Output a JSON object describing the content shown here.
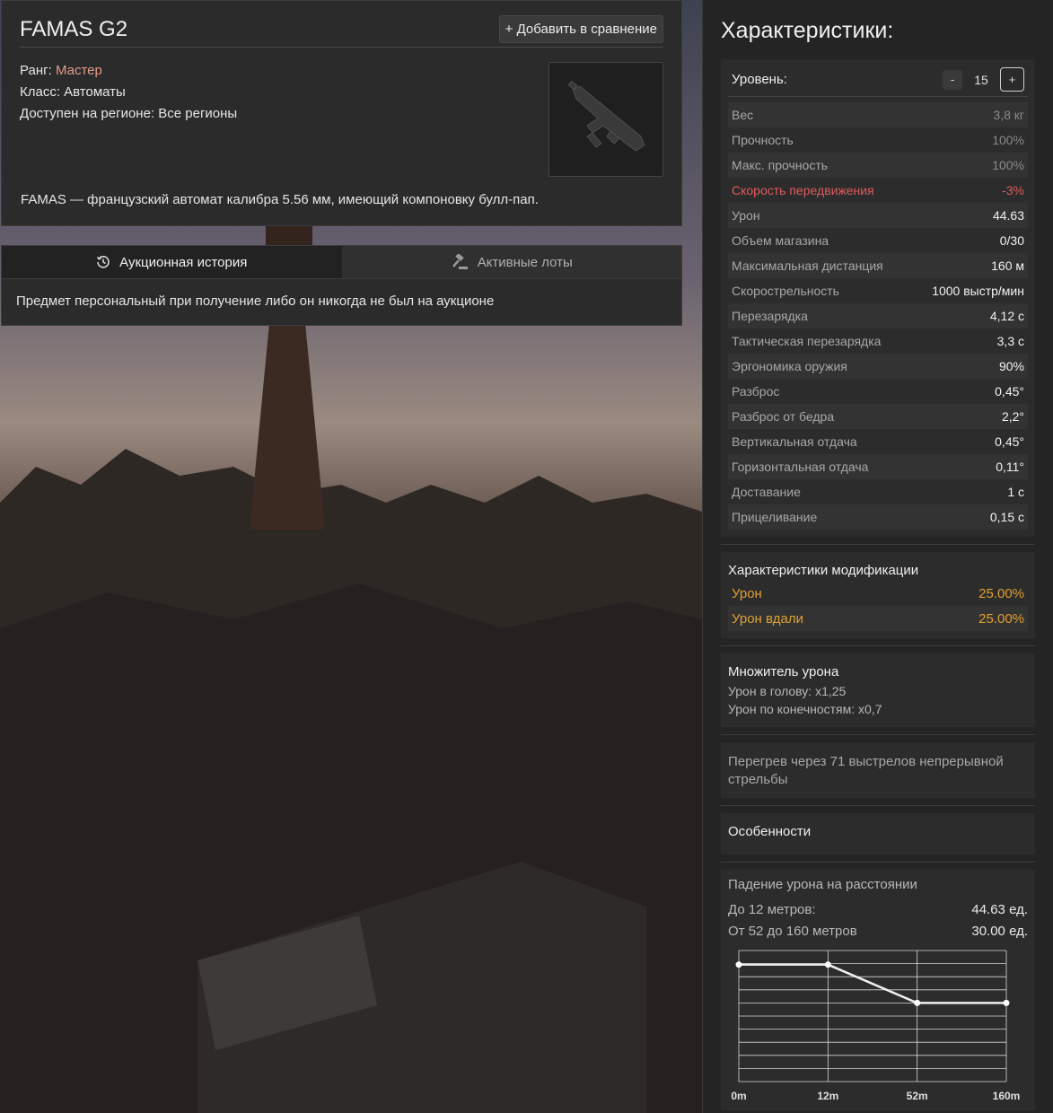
{
  "item": {
    "name": "FAMAS G2",
    "compare_label": "Добавить в сравнение",
    "rank_label": "Ранг:",
    "rank_value": "Мастер",
    "class_line": "Класс: Автоматы",
    "region_line": "Доступен на регионе: Все регионы",
    "description": "FAMAS — французский автомат калибра 5.56 мм, имеющий компоновку булл-пап.",
    "colors": {
      "rank": "#e39b8e"
    }
  },
  "auction": {
    "tabs": [
      {
        "label": "Аукционная история",
        "icon": "history-icon",
        "active": true
      },
      {
        "label": "Активные лоты",
        "icon": "gavel-icon",
        "active": false
      }
    ],
    "message": "Предмет персональный при получение либо он никогда не был на аукционе"
  },
  "stats": {
    "title": "Характеристики:",
    "level_label": "Уровень:",
    "level_value": "15",
    "minus": "-",
    "plus": "+",
    "rows": [
      {
        "name": "Вес",
        "value": "3,8 кг"
      },
      {
        "name": "Прочность",
        "value": "100%"
      },
      {
        "name": "Макс. прочность",
        "value": "100%"
      },
      {
        "name": "Скорость передвижения",
        "value": "-3%"
      },
      {
        "name": "Урон",
        "value": "44.63"
      },
      {
        "name": "Объем магазина",
        "value": "0/30"
      },
      {
        "name": "Максимальная дистанция",
        "value": "160 м"
      },
      {
        "name": "Скорострельность",
        "value": "1000 выстр/мин"
      },
      {
        "name": "Перезарядка",
        "value": "4,12 с"
      },
      {
        "name": "Тактическая перезарядка",
        "value": "3,3 с"
      },
      {
        "name": "Эргономика оружия",
        "value": "90%"
      },
      {
        "name": "Разброс",
        "value": "0,45°"
      },
      {
        "name": "Разброс от бедра",
        "value": "2,2°"
      },
      {
        "name": "Вертикальная отдача",
        "value": "0,45°"
      },
      {
        "name": "Горизонтальная отдача",
        "value": "0,11°"
      },
      {
        "name": "Доставание",
        "value": "1 с"
      },
      {
        "name": "Прицеливание",
        "value": "0,15 с"
      }
    ],
    "colors": {
      "negative": "#e05a5a",
      "modifier": "#e0a030"
    }
  },
  "mods": {
    "title": "Характеристики модификации",
    "rows": [
      {
        "name": "Урон",
        "value": "25.00%"
      },
      {
        "name": "Урон вдали",
        "value": "25.00%"
      }
    ]
  },
  "multiplier": {
    "title": "Множитель урона",
    "head": "Урон в голову: x1,25",
    "limbs": "Урон по конечностям: x0,7"
  },
  "overheat": "Перегрев через 71 выстрелов непрерывной стрельбы",
  "features": "Особенности",
  "falloff": {
    "title": "Падение урона на расстоянии",
    "near_label": "До 12 метров:",
    "near_value": "44.63 ед.",
    "far_label": "От 52 до 160 метров",
    "far_value": "30.00 ед."
  },
  "chart_data": {
    "type": "line",
    "categories": [
      "0m",
      "12m",
      "52m",
      "160m"
    ],
    "values": [
      44.63,
      44.63,
      30.0,
      30.0
    ],
    "ylim": [
      0,
      50
    ],
    "grid": true,
    "xlabel": "",
    "ylabel": ""
  }
}
